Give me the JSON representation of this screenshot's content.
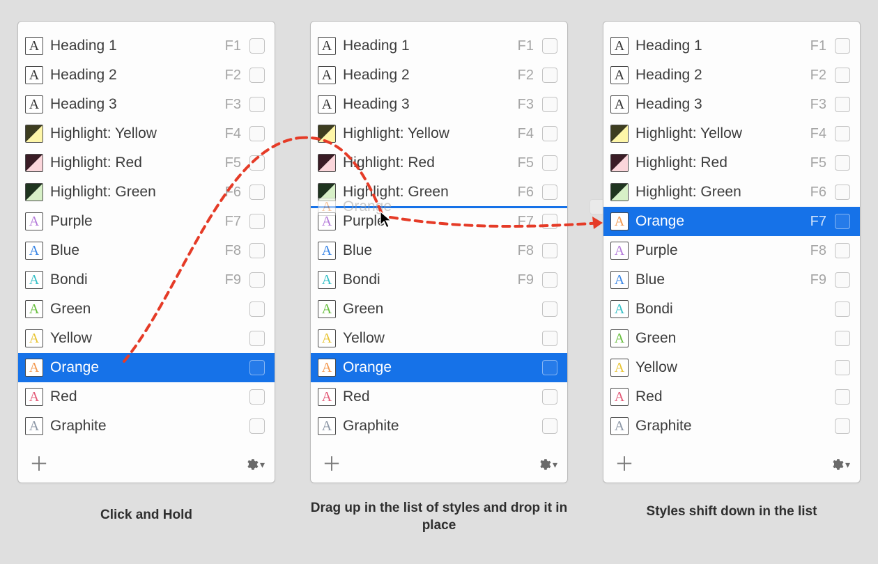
{
  "colors": {
    "selection": "#1672e8",
    "arrow": "#e53b27",
    "panel_bg": "#fdfdfd",
    "page_bg": "#dfdfdf"
  },
  "captions": {
    "p1": "Click and Hold",
    "p2": "Drag up in the list of styles and drop it in place",
    "p3": "Styles shift down in the list"
  },
  "panels": {
    "p1": {
      "rows": [
        {
          "label": "Heading 1",
          "shortcut": "F1",
          "kind": "text",
          "color": "#333333"
        },
        {
          "label": "Heading 2",
          "shortcut": "F2",
          "kind": "text",
          "color": "#333333"
        },
        {
          "label": "Heading 3",
          "shortcut": "F3",
          "kind": "text",
          "color": "#333333"
        },
        {
          "label": "Highlight: Yellow",
          "shortcut": "F4",
          "kind": "highlight",
          "dark": "#3d3d20",
          "light": "#fef6a8"
        },
        {
          "label": "Highlight: Red",
          "shortcut": "F5",
          "kind": "highlight",
          "dark": "#3a1c25",
          "light": "#fbd6db"
        },
        {
          "label": "Highlight: Green",
          "shortcut": "F6",
          "kind": "highlight",
          "dark": "#1f341f",
          "light": "#d7f0c7"
        },
        {
          "label": "Purple",
          "shortcut": "F7",
          "kind": "text",
          "color": "#b57cda"
        },
        {
          "label": "Blue",
          "shortcut": "F8",
          "kind": "text",
          "color": "#3a86e6"
        },
        {
          "label": "Bondi",
          "shortcut": "F9",
          "kind": "text",
          "color": "#35c0c7"
        },
        {
          "label": "Green",
          "shortcut": "",
          "kind": "text",
          "color": "#69bf3f"
        },
        {
          "label": "Yellow",
          "shortcut": "",
          "kind": "text",
          "color": "#e9c536"
        },
        {
          "label": "Orange",
          "shortcut": "",
          "kind": "text",
          "color": "#f29a52",
          "selected": true
        },
        {
          "label": "Red",
          "shortcut": "",
          "kind": "text",
          "color": "#e35a77"
        },
        {
          "label": "Graphite",
          "shortcut": "",
          "kind": "text",
          "color": "#8c97a6"
        }
      ]
    },
    "p2": {
      "drop_after_index": 5,
      "ghost": {
        "label": "Orange",
        "color": "#f29a52"
      },
      "rows": [
        {
          "label": "Heading 1",
          "shortcut": "F1",
          "kind": "text",
          "color": "#333333"
        },
        {
          "label": "Heading 2",
          "shortcut": "F2",
          "kind": "text",
          "color": "#333333"
        },
        {
          "label": "Heading 3",
          "shortcut": "F3",
          "kind": "text",
          "color": "#333333"
        },
        {
          "label": "Highlight: Yellow",
          "shortcut": "F4",
          "kind": "highlight",
          "dark": "#3d3d20",
          "light": "#fef6a8"
        },
        {
          "label": "Highlight: Red",
          "shortcut": "F5",
          "kind": "highlight",
          "dark": "#3a1c25",
          "light": "#fbd6db"
        },
        {
          "label": "Highlight: Green",
          "shortcut": "F6",
          "kind": "highlight",
          "dark": "#1f341f",
          "light": "#d7f0c7"
        },
        {
          "label": "Purple",
          "shortcut": "F7",
          "kind": "text",
          "color": "#b57cda"
        },
        {
          "label": "Blue",
          "shortcut": "F8",
          "kind": "text",
          "color": "#3a86e6"
        },
        {
          "label": "Bondi",
          "shortcut": "F9",
          "kind": "text",
          "color": "#35c0c7"
        },
        {
          "label": "Green",
          "shortcut": "",
          "kind": "text",
          "color": "#69bf3f"
        },
        {
          "label": "Yellow",
          "shortcut": "",
          "kind": "text",
          "color": "#e9c536"
        },
        {
          "label": "Orange",
          "shortcut": "",
          "kind": "text",
          "color": "#f29a52",
          "selected": true
        },
        {
          "label": "Red",
          "shortcut": "",
          "kind": "text",
          "color": "#e35a77"
        },
        {
          "label": "Graphite",
          "shortcut": "",
          "kind": "text",
          "color": "#8c97a6"
        }
      ]
    },
    "p3": {
      "rows": [
        {
          "label": "Heading 1",
          "shortcut": "F1",
          "kind": "text",
          "color": "#333333"
        },
        {
          "label": "Heading 2",
          "shortcut": "F2",
          "kind": "text",
          "color": "#333333"
        },
        {
          "label": "Heading 3",
          "shortcut": "F3",
          "kind": "text",
          "color": "#333333"
        },
        {
          "label": "Highlight: Yellow",
          "shortcut": "F4",
          "kind": "highlight",
          "dark": "#3d3d20",
          "light": "#fef6a8"
        },
        {
          "label": "Highlight: Red",
          "shortcut": "F5",
          "kind": "highlight",
          "dark": "#3a1c25",
          "light": "#fbd6db"
        },
        {
          "label": "Highlight: Green",
          "shortcut": "F6",
          "kind": "highlight",
          "dark": "#1f341f",
          "light": "#d7f0c7"
        },
        {
          "label": "Orange",
          "shortcut": "F7",
          "kind": "text",
          "color": "#f29a52",
          "selected": true
        },
        {
          "label": "Purple",
          "shortcut": "F8",
          "kind": "text",
          "color": "#b57cda"
        },
        {
          "label": "Blue",
          "shortcut": "F9",
          "kind": "text",
          "color": "#3a86e6"
        },
        {
          "label": "Bondi",
          "shortcut": "",
          "kind": "text",
          "color": "#35c0c7"
        },
        {
          "label": "Green",
          "shortcut": "",
          "kind": "text",
          "color": "#69bf3f"
        },
        {
          "label": "Yellow",
          "shortcut": "",
          "kind": "text",
          "color": "#e9c536"
        },
        {
          "label": "Red",
          "shortcut": "",
          "kind": "text",
          "color": "#e35a77"
        },
        {
          "label": "Graphite",
          "shortcut": "",
          "kind": "text",
          "color": "#8c97a6"
        }
      ]
    }
  }
}
